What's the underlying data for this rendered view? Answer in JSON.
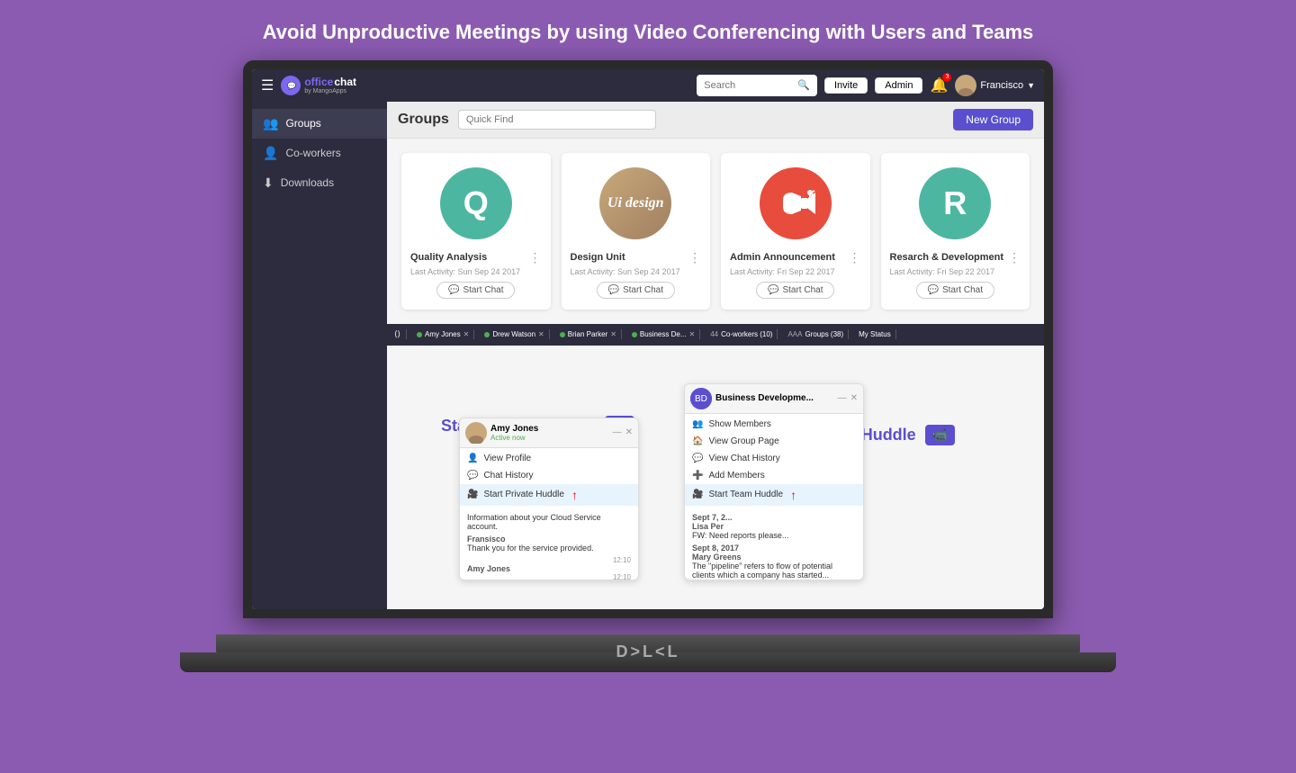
{
  "headline": "Avoid Unproductive Meetings by using Video Conferencing with Users and Teams",
  "topbar": {
    "hamburger": "☰",
    "logo_text": "office chat",
    "logo_sub": "by MangoApps",
    "search_placeholder": "Search",
    "search_label": "Search",
    "invite_label": "Invite",
    "admin_label": "Admin",
    "user_name": "Francisco",
    "notif_count": "3"
  },
  "sidebar": {
    "items": [
      {
        "label": "Groups",
        "icon": "👥",
        "active": true
      },
      {
        "label": "Co-workers",
        "icon": "👤",
        "active": false
      },
      {
        "label": "Downloads",
        "icon": "⬇",
        "active": false
      }
    ]
  },
  "groups_section": {
    "title": "Groups",
    "quick_find_placeholder": "Quick Find",
    "new_group_label": "New Group"
  },
  "group_cards": [
    {
      "id": "quality",
      "initial": "Q",
      "color": "#4DB6A0",
      "name": "Quality Analysis",
      "activity": "Last Activity: Sun Sep 24 2017",
      "btn_label": "Start Chat"
    },
    {
      "id": "design",
      "initial": "Ui design",
      "color": "img",
      "name": "Design Unit",
      "activity": "Last Activity: Sun Sep 24 2017",
      "btn_label": "Start Chat"
    },
    {
      "id": "admin",
      "initial": "📢",
      "color": "#e74c3c",
      "name": "Admin Announcement",
      "activity": "Last Activity: Fri Sep 22 2017",
      "btn_label": "Start Chat"
    },
    {
      "id": "research",
      "initial": "R",
      "color": "#4DB6A0",
      "name": "Resarch & Development",
      "activity": "Last Activity: Fri Sep 22 2017",
      "btn_label": "Start Chat"
    }
  ],
  "chat_amy": {
    "name": "Amy Jones",
    "status": "Active now",
    "menu_items": [
      {
        "label": "View Profile",
        "icon": "👤"
      },
      {
        "label": "Chat History",
        "icon": "💬"
      },
      {
        "label": "Start Private Huddle",
        "icon": "🎥",
        "highlighted": true
      }
    ],
    "messages": [
      {
        "sender": "",
        "text": "Information about your Cloud Service account.",
        "time": ""
      },
      {
        "sender": "Fransisco",
        "text": "Thank you for the service provided.",
        "time": "12:10"
      },
      {
        "sender": "Amy Jones",
        "text": "",
        "time": "12:10"
      }
    ]
  },
  "chat_business": {
    "name": "Business Developme...",
    "menu_items": [
      {
        "label": "Show Members",
        "icon": "👥"
      },
      {
        "label": "View Group Page",
        "icon": "🏠"
      },
      {
        "label": "View Chat History",
        "icon": "💬"
      },
      {
        "label": "Add Members",
        "icon": "➕"
      },
      {
        "label": "Start Team Huddle",
        "icon": "🎥",
        "highlighted": true
      }
    ],
    "messages": [
      {
        "sender": "Sept 7, 2...",
        "text": "",
        "time": ""
      },
      {
        "sender": "Lisa Per",
        "text": "",
        "time": ""
      },
      {
        "sender": "FW: Nee",
        "text": "reports please...",
        "time": ""
      },
      {
        "sender": "Sept 8, 2017",
        "text": "",
        "time": ""
      },
      {
        "sender": "Mary Greens",
        "text": "The 'pipeline' refers to flow of potential clients which a company has started...",
        "time": ""
      }
    ]
  },
  "overlays": {
    "private_huddle_label": "Start Private Huddle",
    "team_huddle_label": "Start Team Huddle"
  },
  "statusbar": {
    "items": [
      {
        "label": "Amy Jones",
        "dot": true
      },
      {
        "label": "Drew Watson",
        "dot": true
      },
      {
        "label": "Brian Parker",
        "dot": true
      },
      {
        "label": "Business De...",
        "dot": true
      },
      {
        "label": "Co-workers (10)",
        "prefix": "44"
      },
      {
        "label": "Groups (38)",
        "prefix": "AAA"
      },
      {
        "label": "My Status",
        "prefix": ""
      }
    ]
  },
  "dell_logo": "D⟩L⟨L"
}
